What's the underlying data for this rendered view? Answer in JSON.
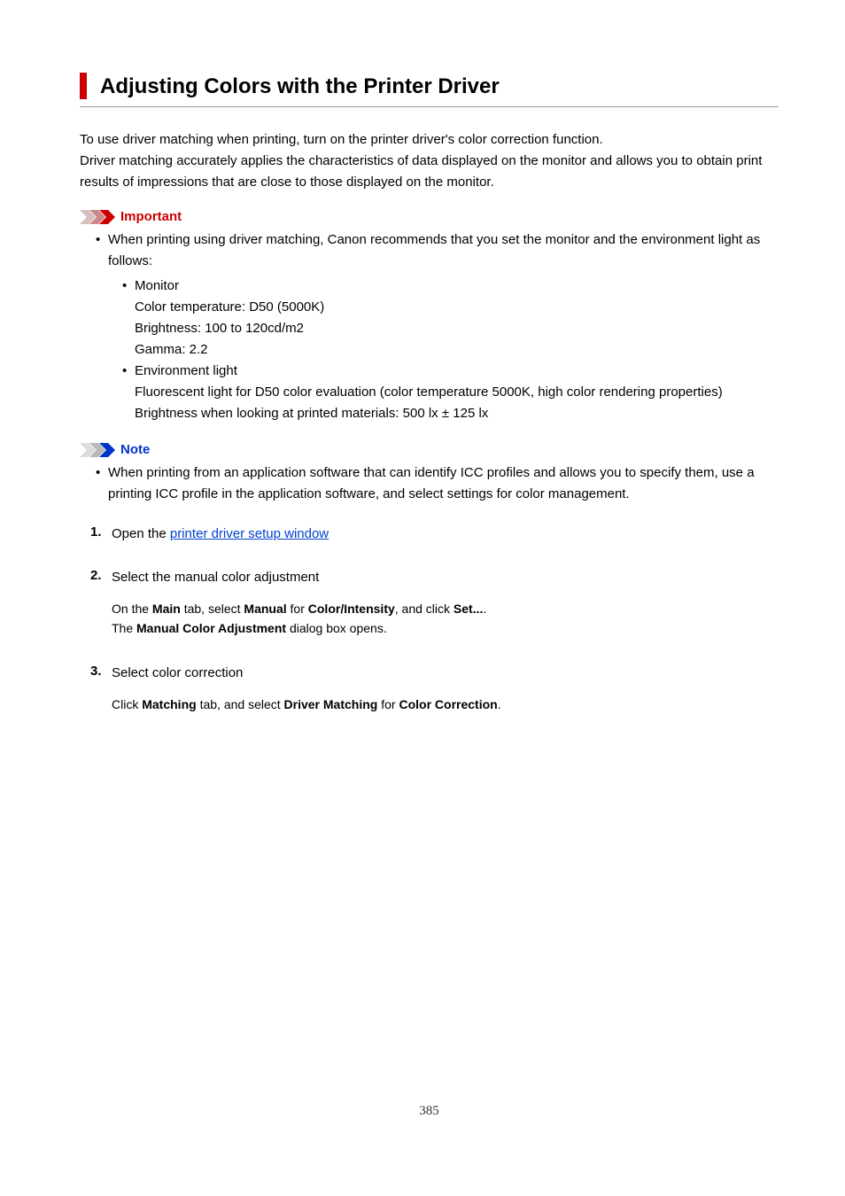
{
  "title": "Adjusting Colors with the Printer Driver",
  "intro": {
    "p1": "To use driver matching when printing, turn on the printer driver's color correction function.",
    "p2": "Driver matching accurately applies the characteristics of data displayed on the monitor and allows you to obtain print results of impressions that are close to those displayed on the monitor."
  },
  "important": {
    "label": "Important",
    "item1": "When printing using driver matching, Canon recommends that you set the monitor and the environment light as follows:",
    "monitor": {
      "label": "Monitor",
      "l1": "Color temperature: D50 (5000K)",
      "l2": "Brightness: 100 to 120cd/m2",
      "l3": "Gamma: 2.2"
    },
    "envlight": {
      "label": "Environment light",
      "l1": "Fluorescent light for D50 color evaluation (color temperature 5000K, high color rendering properties)",
      "l2": "Brightness when looking at printed materials: 500 lx ± 125 lx"
    }
  },
  "note": {
    "label": "Note",
    "item1": "When printing from an application software that can identify ICC profiles and allows you to specify them, use a printing ICC profile in the application software, and select settings for color management."
  },
  "steps": {
    "s1": {
      "num": "1.",
      "prefix": "Open the ",
      "link": "printer driver setup window"
    },
    "s2": {
      "num": "2.",
      "title": "Select the manual color adjustment",
      "body_pre1": "On the ",
      "b1": "Main",
      "body_mid1": " tab, select ",
      "b2": "Manual",
      "body_mid2": " for ",
      "b3": "Color/Intensity",
      "body_mid3": ", and click ",
      "b4": "Set...",
      "body_end1": ".",
      "line2_pre": "The ",
      "line2_b": "Manual Color Adjustment",
      "line2_end": " dialog box opens."
    },
    "s3": {
      "num": "3.",
      "title": "Select color correction",
      "body_pre": "Click ",
      "b1": "Matching",
      "body_mid1": " tab, and select ",
      "b2": "Driver Matching",
      "body_mid2": " for ",
      "b3": "Color Correction",
      "body_end": "."
    }
  },
  "page_number": "385"
}
